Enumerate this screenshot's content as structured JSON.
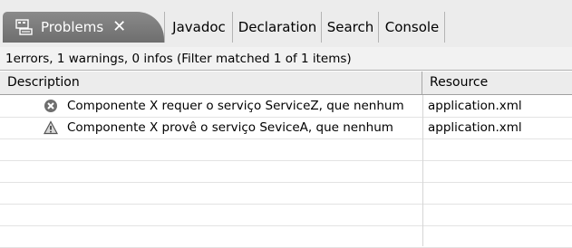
{
  "tabs": {
    "active": {
      "label": "Problems",
      "close": "✕",
      "icon": "problems-icon"
    },
    "others": [
      "Javadoc",
      "Declaration",
      "Search",
      "Console"
    ]
  },
  "status": "1errors, 1 warnings, 0 infos (Filter matched 1 of 1 items)",
  "table": {
    "columns": [
      "Description",
      "Resource"
    ],
    "rows": [
      {
        "severity": "error-icon",
        "description": "Componente X requer o serviço ServiceZ, que nenhum",
        "resource": "application.xml"
      },
      {
        "severity": "warning-icon",
        "description": "Componente X provê o serviço SeviceA, que nenhum",
        "resource": "application.xml"
      }
    ]
  },
  "colors": {
    "active_tab": "#7c7c7c",
    "tabbar_bg": "#ececec",
    "header_bg": "#ececec"
  }
}
